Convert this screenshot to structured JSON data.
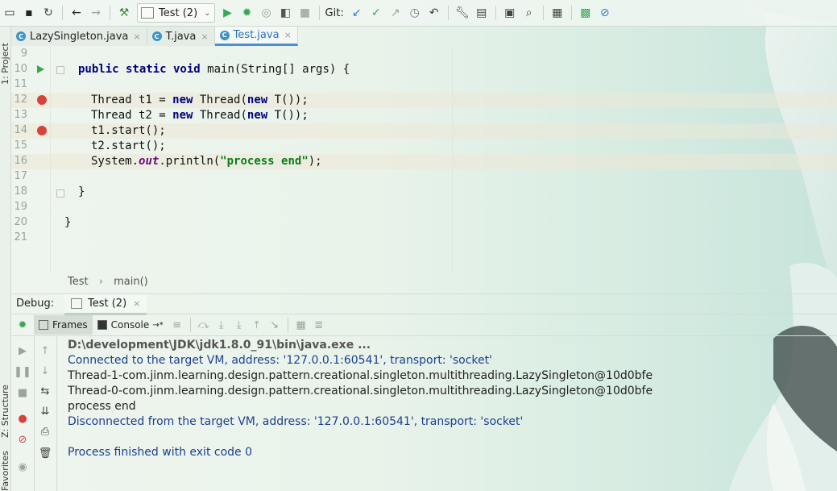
{
  "toolbar": {
    "run_config": "Test (2)",
    "git_label": "Git:",
    "icons": [
      "open-folder-icon",
      "save-icon",
      "sync-icon",
      "back-icon",
      "forward-icon",
      "build-hammer-icon",
      "run-icon",
      "debug-icon",
      "coverage-icon",
      "profile-icon",
      "stop-icon",
      "git-update-icon",
      "git-commit-icon",
      "git-push-icon",
      "history-icon",
      "revert-icon",
      "settings-wrench-icon",
      "project-structure-icon",
      "terminal-icon",
      "search-icon",
      "services-icon",
      "activity-monitor-icon",
      "power-save-icon"
    ]
  },
  "left_strip": {
    "project": "1: Project",
    "structure": "Z: Structure",
    "favorites": "Favorites"
  },
  "tabs": [
    {
      "label": "LazySingleton.java",
      "close": "×"
    },
    {
      "label": "T.java",
      "close": "×"
    },
    {
      "label": "Test.java",
      "close": "×"
    }
  ],
  "editor": {
    "line_numbers": [
      "9",
      "10",
      "11",
      "12",
      "13",
      "14",
      "15",
      "16",
      "17",
      "18",
      "19",
      "20",
      "21"
    ],
    "code": {
      "l10_kw": "public static void ",
      "l10_rest": "main(String[] args) {",
      "l12_a": "Thread t1 = ",
      "l12_new1": "new",
      "l12_b": " Thread(",
      "l12_new2": "new",
      "l12_c": " T());",
      "l13_a": "Thread t2 = ",
      "l13_new1": "new",
      "l13_b": " Thread(",
      "l13_new2": "new",
      "l13_c": " T());",
      "l14": "t1.start();",
      "l15": "t2.start();",
      "l16_a": "System.",
      "l16_out": "out",
      "l16_b": ".println(",
      "l16_str": "\"process end\"",
      "l16_c": ");",
      "l18": "}",
      "l20": "}"
    }
  },
  "breadcrumb": {
    "class": "Test",
    "sep": "›",
    "method": "main()"
  },
  "debug": {
    "label": "Debug:",
    "tab": "Test (2)",
    "tab_close": "×",
    "frames": "Frames",
    "console": "Console",
    "console_suffix": "→*"
  },
  "console": {
    "lines": [
      "D:\\development\\JDK\\jdk1.8.0_91\\bin\\java.exe ...",
      "Connected to the target VM, address: '127.0.0.1:60541', transport: 'socket'",
      "Thread-1-com.jinm.learning.design.pattern.creational.singleton.multithreading.LazySingleton@10d0bfe",
      "Thread-0-com.jinm.learning.design.pattern.creational.singleton.multithreading.LazySingleton@10d0bfe",
      "process end",
      "Disconnected from the target VM, address: '127.0.0.1:60541', transport: 'socket'",
      "",
      "Process finished with exit code 0"
    ]
  },
  "colors": {
    "breakpoint": "#d9413b",
    "run": "#34a853",
    "keyword": "#000080",
    "string": "#067d17",
    "console_info": "#1d3f8f"
  }
}
